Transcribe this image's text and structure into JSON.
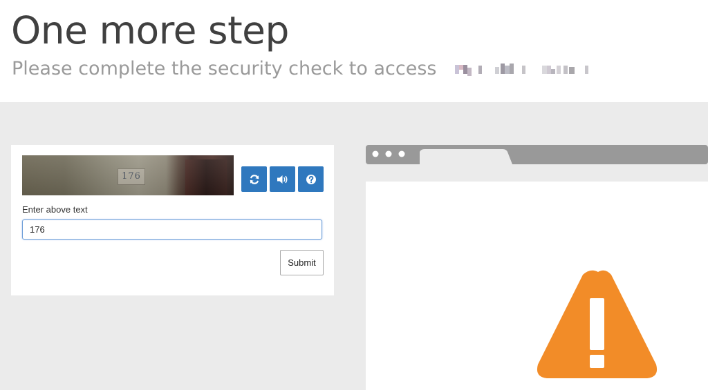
{
  "header": {
    "title": "One more step",
    "subtitle": "Please complete the security check to access"
  },
  "captcha": {
    "image_text": "176",
    "input_label": "Enter above text",
    "input_value": "176",
    "submit_label": "Submit",
    "buttons": [
      {
        "icon": "refresh-icon"
      },
      {
        "icon": "audio-icon"
      },
      {
        "icon": "help-icon"
      }
    ],
    "button_color": "#2f78be"
  },
  "illustration": {
    "warning_color": "#f28c28",
    "frame_color": "#999999"
  }
}
